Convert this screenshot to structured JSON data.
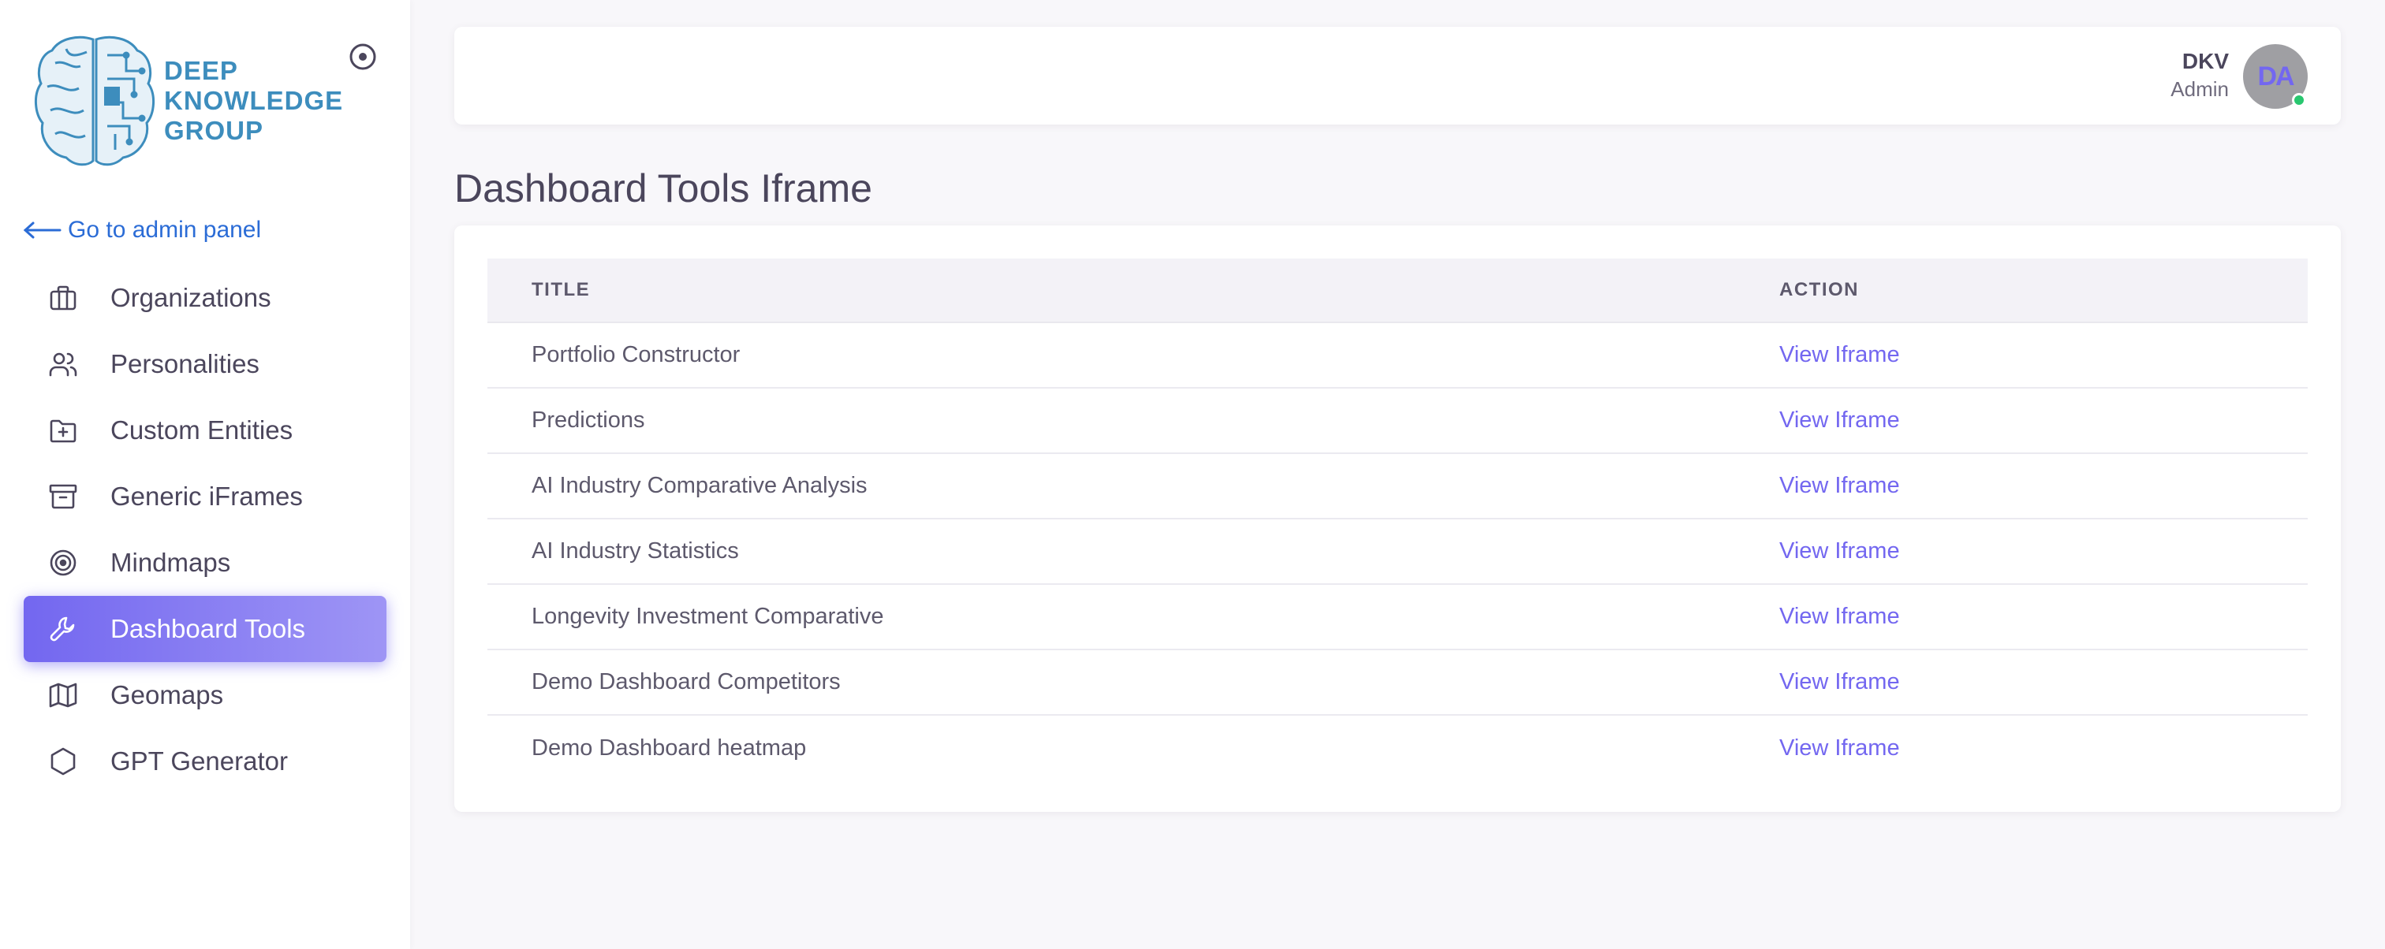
{
  "brand": {
    "logo_lines": [
      "DEEP",
      "KNOWLEDGE",
      "GROUP"
    ],
    "color": "#3d8dbd"
  },
  "sidebar": {
    "back_link": "Go to admin panel",
    "items": [
      {
        "label": "Organizations",
        "icon": "briefcase-icon"
      },
      {
        "label": "Personalities",
        "icon": "users-icon"
      },
      {
        "label": "Custom Entities",
        "icon": "folder-plus-icon"
      },
      {
        "label": "Generic iFrames",
        "icon": "archive-icon"
      },
      {
        "label": "Mindmaps",
        "icon": "target-icon"
      },
      {
        "label": "Dashboard Tools",
        "icon": "wrench-icon",
        "active": true
      },
      {
        "label": "Geomaps",
        "icon": "map-icon"
      },
      {
        "label": "GPT Generator",
        "icon": "hexagon-icon"
      }
    ]
  },
  "header": {
    "user_name": "DKV",
    "user_role": "Admin",
    "avatar_initials": "DA",
    "status": "online"
  },
  "page": {
    "title": "Dashboard Tools Iframe"
  },
  "table": {
    "columns": [
      "TITLE",
      "ACTION"
    ],
    "rows": [
      {
        "title": "Portfolio Constructor",
        "action": "View Iframe"
      },
      {
        "title": "Predictions",
        "action": "View Iframe"
      },
      {
        "title": "AI Industry Comparative Analysis",
        "action": "View Iframe"
      },
      {
        "title": "AI Industry Statistics",
        "action": "View Iframe"
      },
      {
        "title": "Longevity Investment Comparative",
        "action": "View Iframe"
      },
      {
        "title": "Demo Dashboard Competitors",
        "action": "View Iframe"
      },
      {
        "title": "Demo Dashboard heatmap",
        "action": "View Iframe"
      }
    ]
  },
  "colors": {
    "accent": "#7367f0",
    "link": "#2b6cd6",
    "status_online": "#28c76f"
  }
}
